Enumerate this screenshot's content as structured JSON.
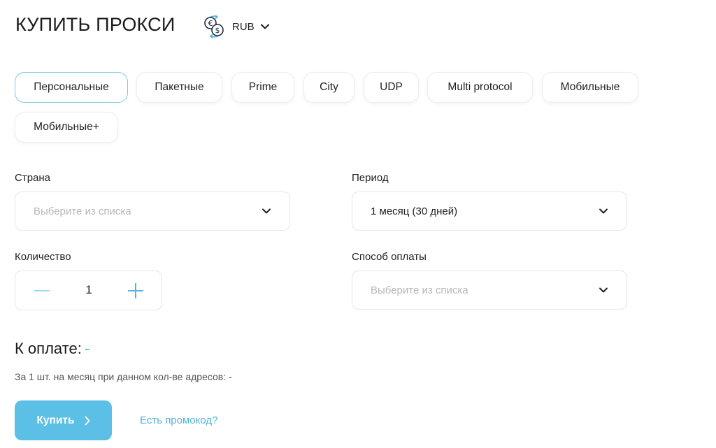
{
  "header": {
    "title": "КУПИТЬ ПРОКСИ",
    "currency": {
      "label": "RUB",
      "icon": "currency-exchange-icon"
    }
  },
  "tabs": [
    {
      "label": "Персональные",
      "active": true
    },
    {
      "label": "Пакетные"
    },
    {
      "label": "Prime"
    },
    {
      "label": "City"
    },
    {
      "label": "UDP"
    },
    {
      "label": "Multi protocol"
    },
    {
      "label": "Мобильные"
    },
    {
      "label": "Мобильные+"
    }
  ],
  "form": {
    "country": {
      "label": "Страна",
      "placeholder": "Выберите из списка"
    },
    "period": {
      "label": "Период",
      "value": "1 месяц (30 дней)"
    },
    "quantity": {
      "label": "Количество",
      "value": "1"
    },
    "payment": {
      "label": "Способ оплаты",
      "placeholder": "Выберите из списка"
    }
  },
  "summary": {
    "total_label": "К оплате:",
    "total_value": "-",
    "per_unit_text": "За 1 шт. на месяц при данном кол-ве адресов: -"
  },
  "actions": {
    "buy_label": "Купить",
    "promo_label": "Есть промокод?"
  },
  "colors": {
    "accent": "#5bbfe6",
    "accent_text": "#53b2dc",
    "active_tab_border": "#7cc8e4",
    "placeholder": "#b3b7bb"
  }
}
